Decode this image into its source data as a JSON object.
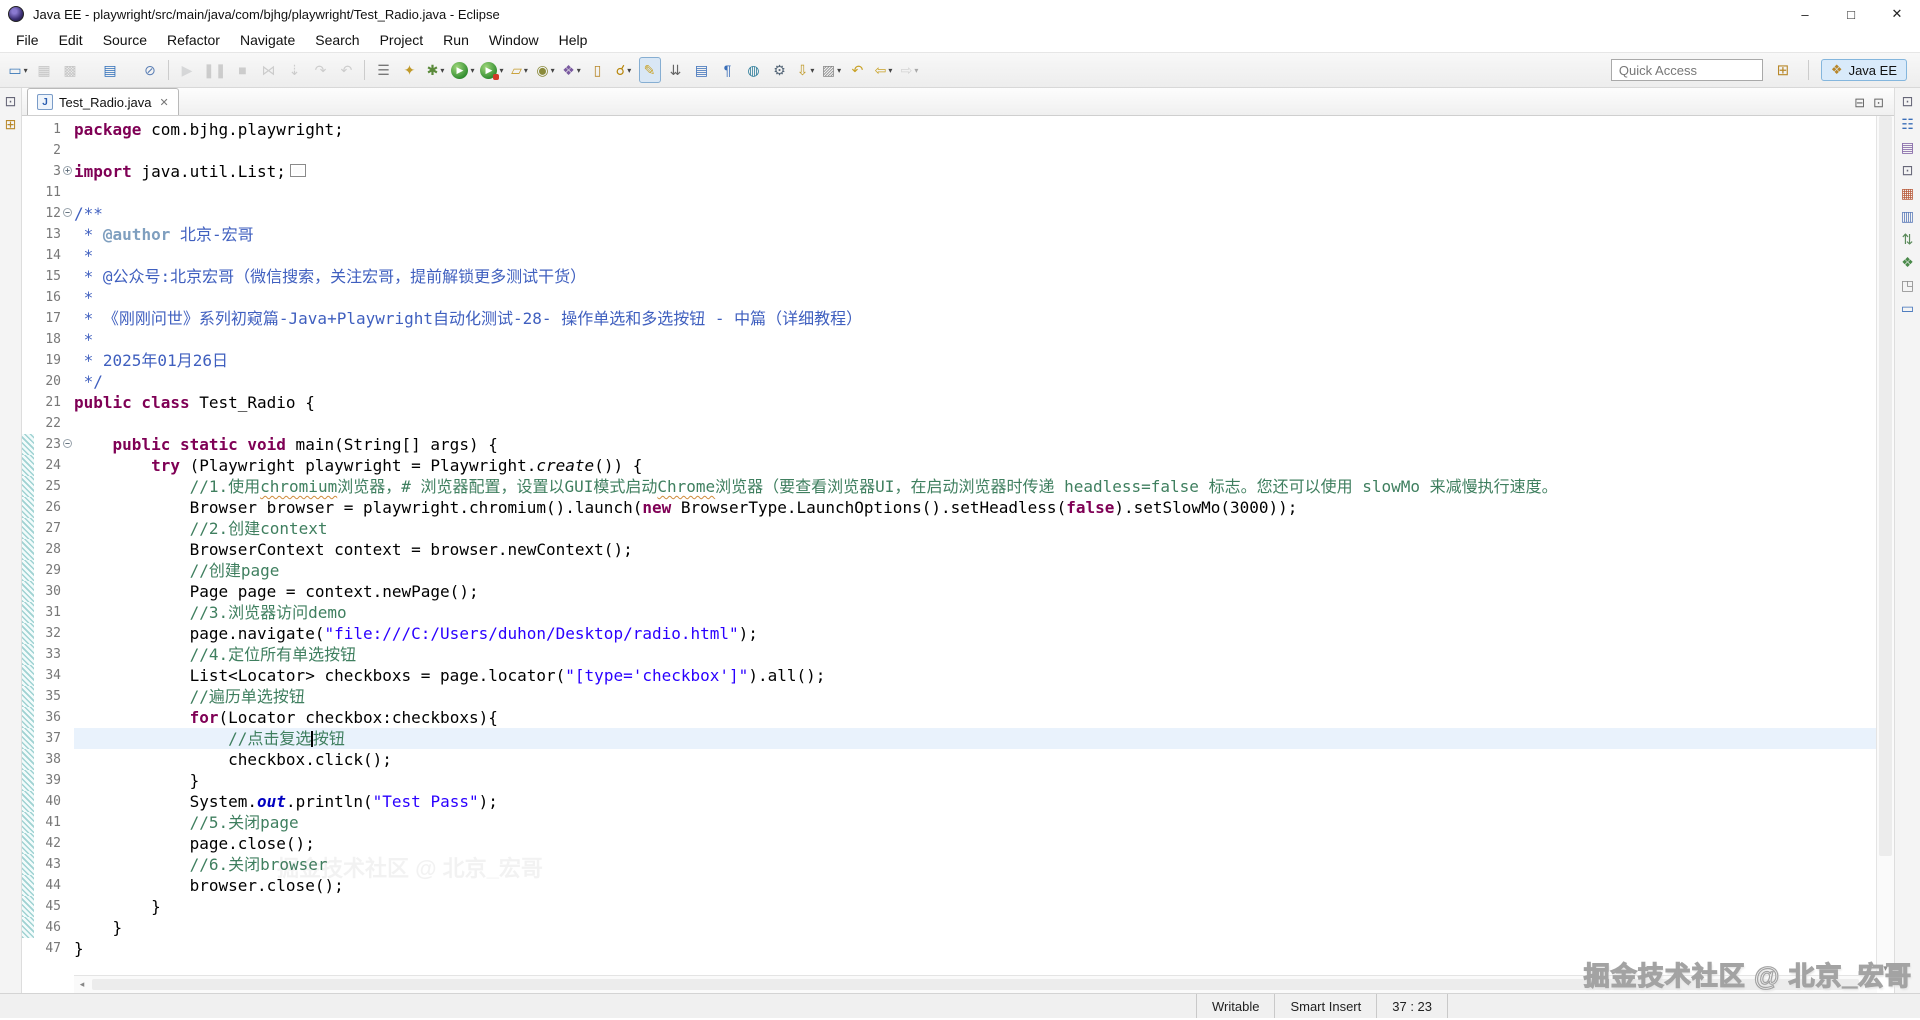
{
  "window": {
    "title": "Java EE - playwright/src/main/java/com/bjhg/playwright/Test_Radio.java - Eclipse",
    "controls": {
      "minimize": "–",
      "maximize": "□",
      "close": "✕"
    }
  },
  "menu": {
    "items": [
      "File",
      "Edit",
      "Source",
      "Refactor",
      "Navigate",
      "Search",
      "Project",
      "Run",
      "Window",
      "Help"
    ]
  },
  "toolbar": {
    "quick_access_placeholder": "Quick Access",
    "open_perspective_glyph": "⊞",
    "perspective": {
      "label": "Java EE",
      "glyph": "❖"
    },
    "icons": [
      {
        "n": "new-wizard",
        "g": "▭",
        "c": "#3a78b8",
        "dd": true
      },
      {
        "n": "save",
        "g": "▦",
        "c": "#888",
        "d": true
      },
      {
        "n": "save-all",
        "g": "▩",
        "c": "#888",
        "d": true
      },
      {
        "n": "open-element",
        "g": "▤",
        "c": "#2f6eb8",
        "gap": true
      },
      {
        "n": "skip-all-breakpoints",
        "g": "⊘",
        "c": "#5b7fb5",
        "gap": true
      },
      {
        "sep": true
      },
      {
        "n": "resume",
        "g": "▶",
        "c": "#9ab6d0",
        "d": true
      },
      {
        "n": "suspend",
        "g": "❚❚",
        "c": "#999",
        "d": true
      },
      {
        "n": "terminate",
        "g": "■",
        "c": "#999",
        "d": true
      },
      {
        "n": "disconnect",
        "g": "⋈",
        "c": "#999",
        "d": true
      },
      {
        "n": "step-into",
        "g": "⇣",
        "c": "#999",
        "d": true
      },
      {
        "n": "step-over",
        "g": "↷",
        "c": "#999",
        "d": true
      },
      {
        "n": "step-return",
        "g": "↶",
        "c": "#999",
        "d": true
      },
      {
        "sep": true
      },
      {
        "n": "run-last-launch",
        "g": "☰",
        "c": "#777"
      },
      {
        "n": "profile",
        "g": "✦",
        "c": "#c09a2a"
      },
      {
        "n": "debug",
        "g": "✱",
        "c": "#5a8a3a",
        "dd": true
      },
      {
        "n": "run",
        "g": "▶",
        "c": "#fff",
        "circle": true,
        "dd": true
      },
      {
        "n": "external-tools",
        "g": "▶",
        "c": "#fff",
        "circle": true,
        "badge": true,
        "dd": true
      },
      {
        "n": "new-web-wizard",
        "g": "▱",
        "c": "#c59a2a",
        "dd": true
      },
      {
        "n": "coverage",
        "g": "◉",
        "c": "#8a8a3a",
        "dd": true
      },
      {
        "n": "java-ee-wizard",
        "g": "❖",
        "c": "#7a5aa0",
        "dd": true
      },
      {
        "n": "open-task",
        "g": "▯",
        "c": "#b8882a"
      },
      {
        "n": "search",
        "g": "☌",
        "c": "#b8860b",
        "dd": true
      },
      {
        "n": "toggle-mark-occurrences",
        "g": "✎",
        "c": "#c9a227",
        "sel": true
      },
      {
        "n": "next-annotation",
        "g": "⇊",
        "c": "#666"
      },
      {
        "n": "open-type-hierarchy",
        "g": "▤",
        "c": "#3a6eb8"
      },
      {
        "n": "show-whitespace",
        "g": "¶",
        "c": "#3a6eb8"
      },
      {
        "n": "web-browser",
        "g": "◍",
        "c": "#2e7d9a"
      },
      {
        "n": "run-on-server",
        "g": "⚙",
        "c": "#556677"
      },
      {
        "n": "import",
        "g": "⇩",
        "c": "#c09a2a",
        "dd": true
      },
      {
        "n": "new-snippet",
        "g": "▨",
        "c": "#888",
        "dd": true
      },
      {
        "n": "last-edit-location",
        "g": "↶",
        "c": "#c9a227"
      },
      {
        "n": "back",
        "g": "⇦",
        "c": "#c9a227",
        "dd": true
      },
      {
        "n": "forward",
        "g": "⇨",
        "c": "#aaa",
        "d": true,
        "dd": true
      }
    ]
  },
  "left_strip": {
    "icons": [
      {
        "n": "restore-view",
        "g": "⊡",
        "c": "#667"
      },
      {
        "n": "package-explorer",
        "g": "⊞",
        "c": "#b8882a"
      }
    ]
  },
  "right_strip": {
    "icons": [
      {
        "n": "restore-view",
        "g": "⊡",
        "c": "#667"
      },
      {
        "n": "outline-view",
        "g": "☷",
        "c": "#3a6eb8"
      },
      {
        "n": "task-list-view",
        "g": "▤",
        "c": "#7a5aa0"
      },
      {
        "n": "restore-editor",
        "g": "⊡",
        "c": "#667"
      },
      {
        "n": "servers-view",
        "g": "▦",
        "c": "#b85a3a"
      },
      {
        "n": "properties-view",
        "g": "▥",
        "c": "#5a7ab8"
      },
      {
        "n": "git-staging-view",
        "g": "⇅",
        "c": "#5a8a5a"
      },
      {
        "n": "project-explorer-view",
        "g": "❖",
        "c": "#4a8a4a"
      },
      {
        "n": "snippets-view",
        "g": "◳",
        "c": "#888"
      },
      {
        "n": "console-view",
        "g": "▭",
        "c": "#3a6eb8"
      }
    ]
  },
  "editor": {
    "tab": {
      "label": "Test_Radio.java",
      "icon_letter": "J",
      "close_glyph": "✕"
    },
    "pane_buttons": {
      "minimize": "⊟",
      "maximize": "⊡"
    },
    "scroll": {
      "down_glyph": "▾",
      "left_glyph": "◂",
      "right_glyph": "▸"
    },
    "lines": [
      {
        "n": 1,
        "segs": [
          {
            "t": "package",
            "c": "kw"
          },
          {
            "t": " com.bjhg.playwright;",
            "c": "pl"
          }
        ]
      },
      {
        "n": 2,
        "segs": []
      },
      {
        "n": 3,
        "fold": "plus",
        "segs": [
          {
            "t": "import",
            "c": "kw"
          },
          {
            "t": " java.util.List;",
            "c": "pl"
          },
          {
            "box": true
          }
        ]
      },
      {
        "n": 11,
        "segs": []
      },
      {
        "n": 12,
        "fold": "minus",
        "segs": [
          {
            "t": "/**",
            "c": "jd"
          }
        ]
      },
      {
        "n": 13,
        "segs": [
          {
            "t": " * ",
            "c": "jd"
          },
          {
            "t": "@author",
            "c": "jdt"
          },
          {
            "t": " 北京-宏哥",
            "c": "jd"
          }
        ]
      },
      {
        "n": 14,
        "segs": [
          {
            "t": " * ",
            "c": "jd"
          }
        ]
      },
      {
        "n": 15,
        "segs": [
          {
            "t": " * @公众号:北京宏哥（微信搜索，关注宏哥，提前解锁更多测试干货）",
            "c": "jd"
          }
        ]
      },
      {
        "n": 16,
        "segs": [
          {
            "t": " * ",
            "c": "jd"
          }
        ]
      },
      {
        "n": 17,
        "segs": [
          {
            "t": " * 《刚刚问世》系列初窥篇-Java+Playwright自动化测试-28- 操作单选和多选按钮 - 中篇（详细教程）",
            "c": "jd"
          }
        ]
      },
      {
        "n": 18,
        "segs": [
          {
            "t": " * ",
            "c": "jd"
          }
        ]
      },
      {
        "n": 19,
        "segs": [
          {
            "t": " * 2025年01月26日",
            "c": "jd"
          }
        ]
      },
      {
        "n": 20,
        "segs": [
          {
            "t": " */",
            "c": "jd"
          }
        ]
      },
      {
        "n": 21,
        "segs": [
          {
            "t": "public class",
            "c": "kw"
          },
          {
            "t": " Test_Radio {",
            "c": "pl"
          }
        ]
      },
      {
        "n": 22,
        "segs": []
      },
      {
        "n": 23,
        "fold": "minus",
        "hatch": true,
        "segs": [
          {
            "t": "\t",
            "c": "pl"
          },
          {
            "t": "public static void",
            "c": "kw"
          },
          {
            "t": " main(String[] args) {",
            "c": "pl"
          }
        ]
      },
      {
        "n": 24,
        "hatch": true,
        "segs": [
          {
            "t": "\t\t",
            "c": "pl"
          },
          {
            "t": "try",
            "c": "kw"
          },
          {
            "t": " (Playwright playwright = Playwright.",
            "c": "pl"
          },
          {
            "t": "create",
            "c": "pl sm"
          },
          {
            "t": "()) {",
            "c": "pl"
          }
        ]
      },
      {
        "n": 25,
        "hatch": true,
        "segs": [
          {
            "t": "\t\t\t",
            "c": "pl"
          },
          {
            "t": "//1.使用",
            "c": "cm"
          },
          {
            "t": "chromium",
            "c": "cm spell"
          },
          {
            "t": "浏览器，# 浏览器配置，设置以GUI模式启动",
            "c": "cm"
          },
          {
            "t": "Chrome",
            "c": "cm spell"
          },
          {
            "t": "浏览器（要查看浏览器UI，在启动浏览器时传递 headless=false 标志。您还可以使用 slowMo 来减慢执行速度。",
            "c": "cm"
          }
        ]
      },
      {
        "n": 26,
        "hatch": true,
        "segs": [
          {
            "t": "\t\t\tBrowser browser = playwright.chromium().launch(",
            "c": "pl"
          },
          {
            "t": "new",
            "c": "kw"
          },
          {
            "t": " BrowserType.LaunchOptions().setHeadless(",
            "c": "pl"
          },
          {
            "t": "false",
            "c": "kw"
          },
          {
            "t": ").setSlowMo(3000));",
            "c": "pl"
          }
        ]
      },
      {
        "n": 27,
        "hatch": true,
        "segs": [
          {
            "t": "\t\t\t",
            "c": "pl"
          },
          {
            "t": "//2.创建context",
            "c": "cm"
          }
        ]
      },
      {
        "n": 28,
        "hatch": true,
        "segs": [
          {
            "t": "\t\t\tBrowserContext context = browser.newContext();",
            "c": "pl"
          }
        ]
      },
      {
        "n": 29,
        "hatch": true,
        "segs": [
          {
            "t": "\t\t\t",
            "c": "pl"
          },
          {
            "t": "//创建page",
            "c": "cm"
          }
        ]
      },
      {
        "n": 30,
        "hatch": true,
        "segs": [
          {
            "t": "\t\t\tPage page = context.newPage();",
            "c": "pl"
          }
        ]
      },
      {
        "n": 31,
        "hatch": true,
        "segs": [
          {
            "t": "\t\t\t",
            "c": "pl"
          },
          {
            "t": "//3.浏览器访问demo",
            "c": "cm"
          }
        ]
      },
      {
        "n": 32,
        "hatch": true,
        "segs": [
          {
            "t": "\t\t\tpage.navigate(",
            "c": "pl"
          },
          {
            "t": "\"file:///C:/Users/duhon/Desktop/radio.html\"",
            "c": "str"
          },
          {
            "t": ");",
            "c": "pl"
          }
        ]
      },
      {
        "n": 33,
        "hatch": true,
        "segs": [
          {
            "t": "\t\t\t",
            "c": "pl"
          },
          {
            "t": "//4.定位所有单选按钮",
            "c": "cm"
          }
        ]
      },
      {
        "n": 34,
        "hatch": true,
        "segs": [
          {
            "t": "\t\t\tList<Locator> checkboxs = page.locator(",
            "c": "pl"
          },
          {
            "t": "\"[type='checkbox']\"",
            "c": "str"
          },
          {
            "t": ").all();",
            "c": "pl"
          }
        ]
      },
      {
        "n": 35,
        "hatch": true,
        "segs": [
          {
            "t": "\t\t\t",
            "c": "pl"
          },
          {
            "t": "//遍历单选按钮",
            "c": "cm"
          }
        ]
      },
      {
        "n": 36,
        "hatch": true,
        "segs": [
          {
            "t": "\t\t\t",
            "c": "pl"
          },
          {
            "t": "for",
            "c": "kw"
          },
          {
            "t": "(Locator checkbox:checkboxs){",
            "c": "pl"
          }
        ]
      },
      {
        "n": 37,
        "hatch": true,
        "cur": true,
        "segs": [
          {
            "t": "\t\t\t\t",
            "c": "pl"
          },
          {
            "t": "//点击复选",
            "c": "cm"
          },
          {
            "caret": true
          },
          {
            "t": "按钮",
            "c": "cm"
          }
        ]
      },
      {
        "n": 38,
        "hatch": true,
        "segs": [
          {
            "t": "\t\t\t\tcheckbox.click();",
            "c": "pl"
          }
        ]
      },
      {
        "n": 39,
        "hatch": true,
        "segs": [
          {
            "t": "\t\t\t}",
            "c": "pl"
          }
        ]
      },
      {
        "n": 40,
        "hatch": true,
        "segs": [
          {
            "t": "\t\t\tSystem.",
            "c": "pl"
          },
          {
            "t": "out",
            "c": "sf"
          },
          {
            "t": ".println(",
            "c": "pl"
          },
          {
            "t": "\"Test Pass\"",
            "c": "str"
          },
          {
            "t": ");",
            "c": "pl"
          }
        ]
      },
      {
        "n": 41,
        "hatch": true,
        "segs": [
          {
            "t": "\t\t\t",
            "c": "pl"
          },
          {
            "t": "//5.关闭page",
            "c": "cm"
          }
        ]
      },
      {
        "n": 42,
        "hatch": true,
        "segs": [
          {
            "t": "\t\t\tpage.close();",
            "c": "pl"
          }
        ]
      },
      {
        "n": 43,
        "hatch": true,
        "segs": [
          {
            "t": "\t\t\t",
            "c": "pl"
          },
          {
            "t": "//6.关闭browser",
            "c": "cm"
          }
        ]
      },
      {
        "n": 44,
        "hatch": true,
        "segs": [
          {
            "t": "\t\t\tbrowser.close();",
            "c": "pl"
          }
        ]
      },
      {
        "n": 45,
        "hatch": true,
        "segs": [
          {
            "t": "\t\t}",
            "c": "pl"
          }
        ]
      },
      {
        "n": 46,
        "hatch": true,
        "segs": [
          {
            "t": "\t}",
            "c": "pl"
          }
        ]
      },
      {
        "n": 47,
        "segs": [
          {
            "t": "}",
            "c": "pl"
          }
        ]
      }
    ]
  },
  "status_bar": {
    "writable": "Writable",
    "insert_mode": "Smart Insert",
    "cursor_position": "37 : 23"
  },
  "watermark": {
    "bottom_right": "掘金技术社区 @ 北京_宏哥",
    "faint": "掘金技术社区 @ 北京_宏哥"
  },
  "colors": {
    "keyword": "#7f0055",
    "comment": "#3f7f5f",
    "javadoc": "#3f5fbf",
    "string": "#2a00ff",
    "current_line": "#e9f2fc",
    "perspective_bg": "#d9eafa",
    "hatch": "#9fd2d2"
  }
}
